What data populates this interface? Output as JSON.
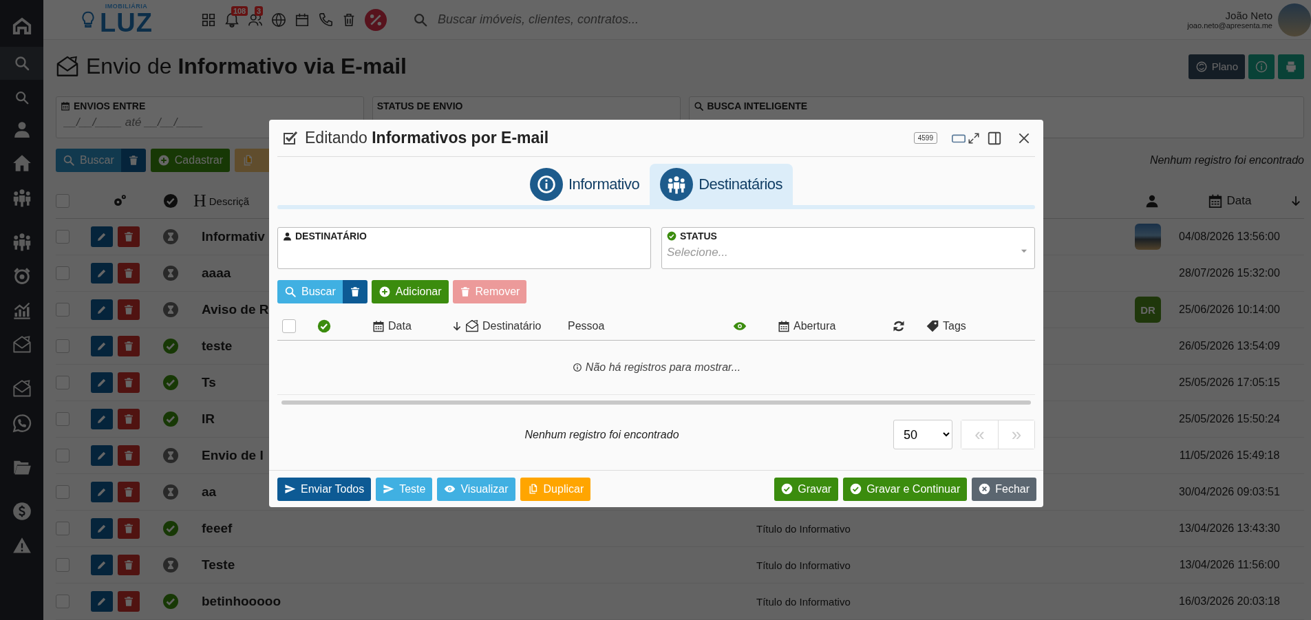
{
  "topbar": {
    "logo": {
      "tagline": "IMOBILIÁRIA",
      "name": "LUZ"
    },
    "badges": {
      "notifications": "108",
      "people": "3"
    },
    "search": {
      "placeholder": "Buscar imóveis, clientes, contratos..."
    },
    "user": {
      "name": "João Neto",
      "email": "joao.neto@apresenta.me"
    }
  },
  "page": {
    "title": "Envio de **Informativo via E-mail**",
    "plan_button": "Plano"
  },
  "filters": [
    {
      "kind": "date_range",
      "label": "ENVIOS ENTRE",
      "placeholder": "__/__/____ até __/__/____"
    },
    {
      "kind": "select",
      "label": "STATUS DE ENVIO"
    },
    {
      "kind": "search",
      "label": "BUSCA INTELIGENTE"
    }
  ],
  "actions": {
    "search": "Buscar",
    "create": "Cadastrar",
    "result_message": "Nenhum registro foi encontrado"
  },
  "table": {
    "all_checked": false,
    "columns": {
      "description_icon": "H",
      "description": "Descriçã",
      "date": "Data"
    },
    "rows": [
      {
        "checked": false,
        "sent": false,
        "title": "Informativ",
        "avatar": {
          "kind": "photo"
        },
        "date": "04/08/2026 13:56:00"
      },
      {
        "checked": false,
        "sent": false,
        "title": "aaaa",
        "date": "28/07/2026 15:32:00"
      },
      {
        "checked": false,
        "sent": false,
        "title": "Aviso de R",
        "avatar": {
          "kind": "initials",
          "text": "DR"
        },
        "date": "25/06/2026 10:14:00"
      },
      {
        "checked": false,
        "sent": true,
        "title": "teste",
        "date": "26/05/2026 13:54:09"
      },
      {
        "checked": false,
        "sent": true,
        "title": "Ts",
        "date": "25/05/2026 17:05:15"
      },
      {
        "checked": false,
        "sent": true,
        "title": "IR",
        "date": "25/05/2026 15:50:24"
      },
      {
        "checked": false,
        "sent": false,
        "title": "Envio de I",
        "date": "11/05/2026 15:49:18"
      },
      {
        "checked": false,
        "sent": false,
        "title": "aa",
        "date": "30/04/2026 09:03:51"
      },
      {
        "checked": false,
        "sent": true,
        "title": "feeef",
        "subject": "Título do Informativo",
        "date": "13/04/2026 13:43:30"
      },
      {
        "checked": false,
        "sent": false,
        "title": "Teste",
        "subject": "Título do Informativo",
        "date": "13/04/2026 11:56:00"
      },
      {
        "checked": false,
        "sent": true,
        "title": "betinhooooo",
        "subject": "Título do Informativo",
        "date": "16/03/2026 20:03:18"
      }
    ]
  },
  "modal": {
    "title": "Editando **Informativos por E-mail**",
    "record_id": "4599",
    "tabs": [
      {
        "kind": "info",
        "label": "Informativo",
        "selected": false
      },
      {
        "kind": "people",
        "label": "Destinatários",
        "selected": true
      }
    ],
    "fields": [
      {
        "kind": "text",
        "label": "DESTINATÁRIO"
      },
      {
        "kind": "select",
        "label": "STATUS",
        "placeholder": "Selecione..."
      }
    ],
    "toolbar": {
      "search": "Buscar",
      "add": "Adicionar",
      "remove": {
        "label": "Remover",
        "disabled": true
      }
    },
    "grid": {
      "all_checked": false,
      "columns": {
        "date": "Data",
        "recipient": "Destinatário",
        "person": "Pessoa",
        "opened": "Abertura",
        "tags": "Tags"
      },
      "empty_message": "Não há registros para mostrar..."
    },
    "footer": {
      "message": "Nenhum registro foi encontrado",
      "page_size": "50",
      "pager": {
        "first": "«",
        "next": "»",
        "disabled": true
      }
    },
    "buttons": [
      {
        "kind": "send_all",
        "label": "Enviar Todos"
      },
      {
        "kind": "test",
        "label": "Teste"
      },
      {
        "kind": "preview",
        "label": "Visualizar"
      },
      {
        "kind": "duplicate",
        "label": "Duplicar"
      },
      {
        "kind": "save",
        "label": "Gravar"
      },
      {
        "kind": "save_continue",
        "label": "Gravar e Continuar"
      },
      {
        "kind": "close",
        "label": "Fechar"
      }
    ]
  }
}
